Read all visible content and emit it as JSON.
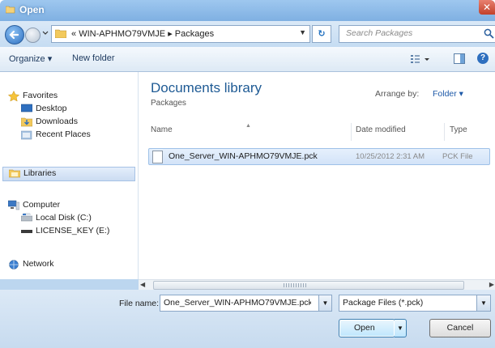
{
  "window": {
    "title": "Open"
  },
  "nav": {
    "address_prefix": "«",
    "address_path": [
      "WIN-APHMO79VMJE",
      "Packages"
    ],
    "search_placeholder": "Search Packages"
  },
  "toolbar": {
    "organize_label": "Organize ▾",
    "new_folder_label": "New folder"
  },
  "sidebar": {
    "favorites": {
      "label": "Favorites",
      "items": [
        "Desktop",
        "Downloads",
        "Recent Places"
      ]
    },
    "libraries": {
      "label": "Libraries"
    },
    "computer": {
      "label": "Computer",
      "items": [
        "Local Disk (C:)",
        "LICENSE_KEY (E:)"
      ]
    },
    "network": {
      "label": "Network"
    }
  },
  "library": {
    "title": "Documents library",
    "subtitle": "Packages",
    "arrange_label": "Arrange by:",
    "arrange_value": "Folder ▾"
  },
  "columns": [
    "Name",
    "Date modified",
    "Type"
  ],
  "files": [
    {
      "name": "One_Server_WIN-APHMO79VMJE.pck",
      "date": "10/25/2012 2:31 AM",
      "type": "PCK File"
    }
  ],
  "footer": {
    "filename_label": "File name:",
    "filename_value": "One_Server_WIN-APHMO79VMJE.pck",
    "filetype_value": "Package Files (*.pck)",
    "open_label": "Open",
    "cancel_label": "Cancel"
  }
}
